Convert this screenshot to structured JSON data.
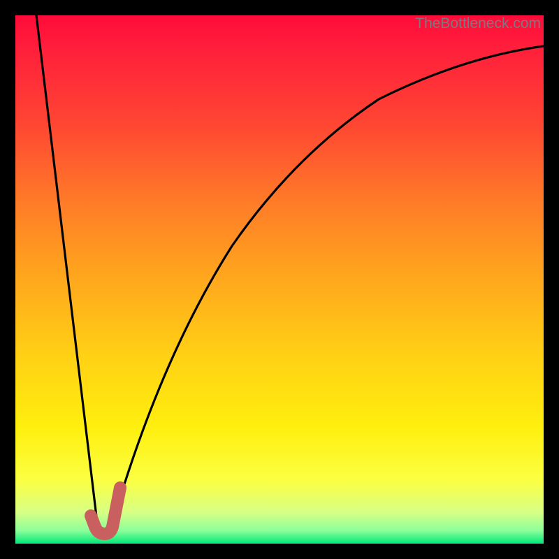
{
  "watermark": "TheBottleneck.com",
  "chart_data": {
    "type": "line",
    "title": "",
    "xlabel": "",
    "ylabel": "",
    "xlim": [
      0,
      100
    ],
    "ylim": [
      0,
      100
    ],
    "series": [
      {
        "name": "bottleneck-curve",
        "x": [
          4,
          5,
          6,
          7,
          8,
          9,
          10,
          11,
          12,
          13,
          14,
          15,
          16,
          17,
          18,
          19,
          20,
          22,
          24,
          26,
          28,
          30,
          33,
          36,
          40,
          45,
          50,
          55,
          60,
          65,
          70,
          75,
          80,
          85,
          90,
          95,
          100
        ],
        "values": [
          100,
          91,
          82,
          73,
          64,
          55,
          46,
          37,
          28,
          19,
          10,
          3,
          1,
          3,
          8,
          14,
          20,
          30,
          38,
          45,
          51,
          56,
          62,
          67,
          72,
          77,
          81,
          84,
          86.5,
          88.5,
          90,
          91.2,
          92.1,
          92.8,
          93.4,
          93.8,
          94.1
        ]
      },
      {
        "name": "highlight-segment",
        "x": [
          14.5,
          15.0,
          15.5,
          16.0,
          16.5,
          17.0,
          17.5,
          18.0,
          18.5,
          19.0,
          19.4
        ],
        "values": [
          3.0,
          2.4,
          2.1,
          2.0,
          2.0,
          2.4,
          3.4,
          5.0,
          7.0,
          9.0,
          10.6
        ]
      }
    ],
    "colors": {
      "curve": "#000000",
      "highlight": "#c9605f",
      "gradient_top": "#ff0b3a",
      "gradient_bottom": "#00e87a"
    }
  }
}
